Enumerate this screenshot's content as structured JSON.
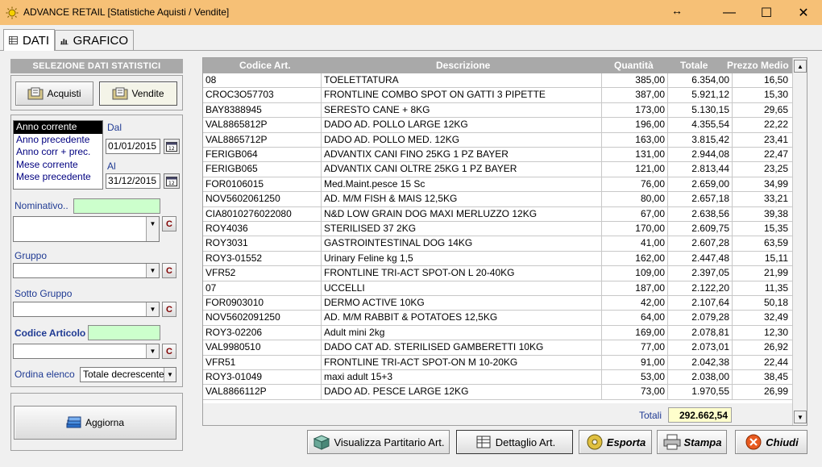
{
  "window": {
    "title": "ADVANCE RETAIL  [Statistiche Aquisti / Vendite]",
    "resize_glyph": "↔",
    "min_glyph": "—",
    "max_glyph": "☐",
    "close_glyph": "✕"
  },
  "tabs": [
    {
      "label": "DATI",
      "icon": "grid-icon"
    },
    {
      "label": "GRAFICO",
      "icon": "bar-chart-icon"
    }
  ],
  "left": {
    "header": "SELEZIONE DATI STATISTICI",
    "acquisti_label": "Acquisti",
    "vendite_label": "Vendite",
    "periods": [
      "Anno corrente",
      "Anno precedente",
      "Anno corr + prec.",
      "Mese corrente",
      "Mese precedente"
    ],
    "dal_label": "Dal",
    "dal_value": "01/01/2015",
    "al_label": "Al",
    "al_value": "31/12/2015",
    "nominativo_label": "Nominativo..",
    "gruppo_label": "Gruppo",
    "sotto_gruppo_label": "Sotto Gruppo",
    "codice_articolo_label": "Codice Articolo",
    "c_label": "C",
    "ordina_label": "Ordina elenco",
    "ordina_value": "Totale decrescente",
    "aggiorna_label": "Aggiorna"
  },
  "grid": {
    "headers": [
      "Codice Art.",
      "Descrizione",
      "Quantità",
      "Totale",
      "Prezzo Medio"
    ],
    "rows": [
      [
        "08",
        "TOELETTATURA",
        "385,00",
        "6.354,00",
        "16,50"
      ],
      [
        "CROC3O57703",
        "FRONTLINE COMBO SPOT ON GATTI 3 PIPETTE",
        "387,00",
        "5.921,12",
        "15,30"
      ],
      [
        "BAY8388945",
        "SERESTO CANE + 8KG",
        "173,00",
        "5.130,15",
        "29,65"
      ],
      [
        "VAL8865812P",
        "DADO AD. POLLO LARGE 12KG",
        "196,00",
        "4.355,54",
        "22,22"
      ],
      [
        "VAL8865712P",
        "DADO AD. POLLO MED. 12KG",
        "163,00",
        "3.815,42",
        "23,41"
      ],
      [
        "FERIGB064",
        "ADVANTIX CANI FINO 25KG  1 PZ BAYER",
        "131,00",
        "2.944,08",
        "22,47"
      ],
      [
        "FERIGB065",
        "ADVANTIX CANI OLTRE 25KG 1 PZ BAYER",
        "121,00",
        "2.813,44",
        "23,25"
      ],
      [
        "FOR0106015",
        "Med.Maint.pesce 15 Sc",
        "76,00",
        "2.659,00",
        "34,99"
      ],
      [
        "NOV5602061250",
        "AD. M/M FISH & MAIS 12,5KG",
        "80,00",
        "2.657,18",
        "33,21"
      ],
      [
        "CIA8010276022080",
        "N&D LOW GRAIN DOG MAXI MERLUZZO 12KG",
        "67,00",
        "2.638,56",
        "39,38"
      ],
      [
        "ROY4036",
        "STERILISED 37 2KG",
        "170,00",
        "2.609,75",
        "15,35"
      ],
      [
        "ROY3031",
        "GASTROINTESTINAL DOG 14KG",
        "41,00",
        "2.607,28",
        "63,59"
      ],
      [
        "ROY3-01552",
        "Urinary Feline kg 1,5",
        "162,00",
        "2.447,48",
        "15,11"
      ],
      [
        "VFR52",
        "FRONTLINE TRI-ACT SPOT-ON L 20-40KG",
        "109,00",
        "2.397,05",
        "21,99"
      ],
      [
        "07",
        "UCCELLI",
        "187,00",
        "2.122,20",
        "11,35"
      ],
      [
        "FOR0903010",
        "DERMO ACTIVE 10KG",
        "42,00",
        "2.107,64",
        "50,18"
      ],
      [
        "NOV5602091250",
        "AD. M/M RABBIT & POTATOES 12,5KG",
        "64,00",
        "2.079,28",
        "32,49"
      ],
      [
        "ROY3-02206",
        "Adult mini 2kg",
        "169,00",
        "2.078,81",
        "12,30"
      ],
      [
        "VAL9980510",
        "DADO CAT AD. STERILISED GAMBERETTI 10KG",
        "77,00",
        "2.073,01",
        "26,92"
      ],
      [
        "VFR51",
        "FRONTLINE TRI-ACT SPOT-ON M 10-20KG",
        "91,00",
        "2.042,38",
        "22,44"
      ],
      [
        "ROY3-01049",
        "maxi adult 15+3",
        "53,00",
        "2.038,00",
        "38,45"
      ],
      [
        "VAL8866112P",
        "DADO AD. PESCE LARGE 12KG",
        "73,00",
        "1.970,55",
        "26,99"
      ]
    ],
    "totals_label": "Totali",
    "totals_value": "292.662,54"
  },
  "buttons": {
    "partitario": "Visualizza Partitario Art.",
    "dettaglio": "Dettaglio Art.",
    "esporta": "Esporta",
    "stampa": "Stampa",
    "chiudi": "Chiudi"
  }
}
